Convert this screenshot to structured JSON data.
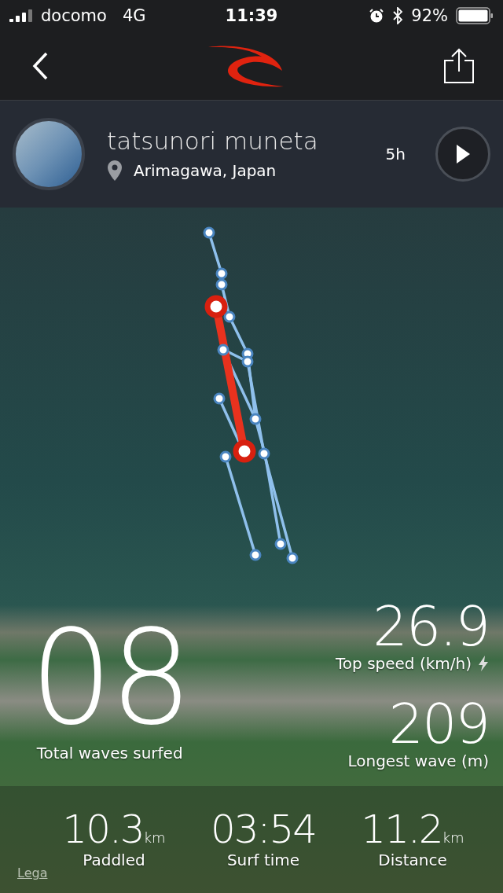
{
  "status_bar": {
    "carrier": "docomo",
    "network": "4G",
    "time": "11:39",
    "battery": "92%"
  },
  "profile": {
    "name": "tatsunori muneta",
    "location": "Arimagawa, Japan",
    "time_ago": "5h"
  },
  "stats": {
    "waves": {
      "value": "08",
      "label": "Total waves surfed"
    },
    "top_speed": {
      "value": "26.9",
      "label": "Top speed (km/h)"
    },
    "longest_wave": {
      "value": "209",
      "label": "Longest wave (m)"
    }
  },
  "summary": [
    {
      "value": "10.3",
      "unit": "km",
      "label": "Paddled"
    },
    {
      "value": "03:54",
      "label": "Surf time"
    },
    {
      "value": "11.2",
      "unit": "km",
      "label": "Distance"
    }
  ],
  "map": {
    "legal_link": "Lega"
  }
}
